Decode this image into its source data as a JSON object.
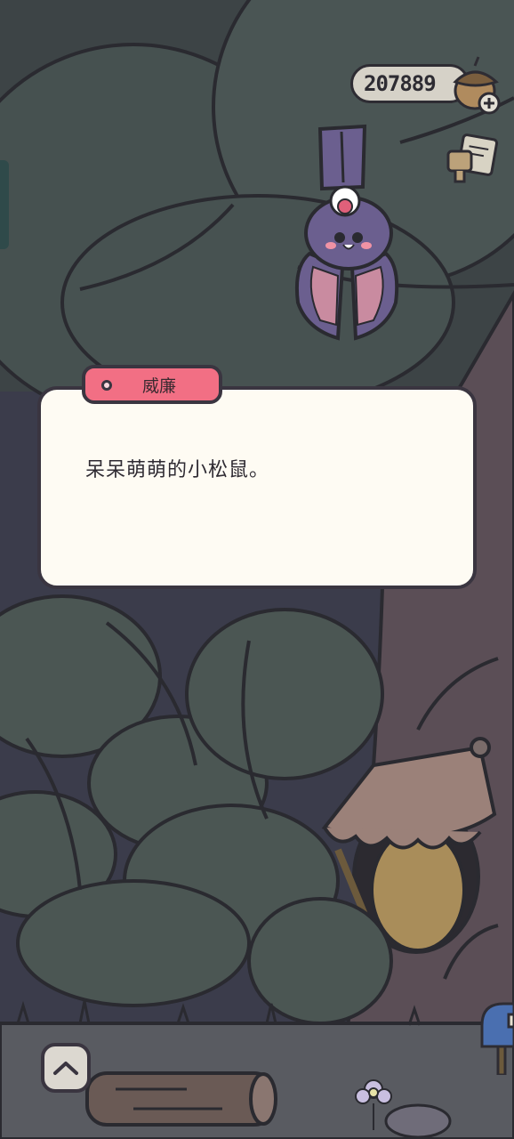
{
  "hud": {
    "acorn_count": "207889",
    "acorn_add_icon": "plus-icon",
    "letter_icon": "letter-icon"
  },
  "dialog": {
    "speaker": "威廉",
    "text": "呆呆萌萌的小松鼠。"
  },
  "controls": {
    "collapse_icon": "chevron-up-icon",
    "mailbox_icon": "mailbox-icon"
  },
  "colors": {
    "name_tag": "#f26f84",
    "dialog_bg": "#fefbf3",
    "outline": "#3a3540",
    "bat_purple": "#6b5f8f",
    "bat_wing_pink": "#c98ba0"
  }
}
